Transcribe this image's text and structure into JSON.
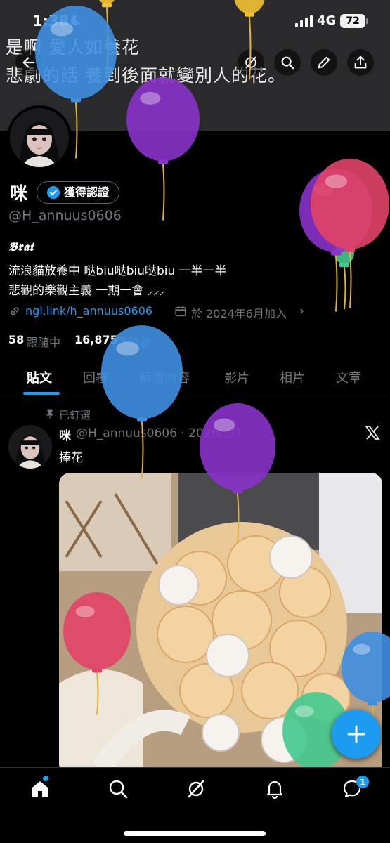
{
  "status_bar": {
    "time": "1:38",
    "network": "4G",
    "battery": "72"
  },
  "banner": {
    "line1": "是啊 愛人如養花",
    "line2": "悲劇的話 養到後面就變別人的花。"
  },
  "profile": {
    "name": "咪",
    "verify_label": "獲得認證",
    "handle": "@H_annuus0606",
    "bio_title": "𝕭𝖗𝖆𝖙",
    "bio_line1": "流浪貓放養中 哒biu哒biu哒biu 一半一半",
    "bio_line2": "悲觀的樂觀主義 一期一會 ⸝⸝⸝",
    "link": "ngl.link/h_annuus0606",
    "joined": "於 2024年6月加入",
    "following_count": "58",
    "following_label": "跟隨中",
    "followers_count": "16,875",
    "followers_label": "跟隨者"
  },
  "tabs": [
    {
      "label": "貼文",
      "active": true
    },
    {
      "label": "回覆",
      "active": false
    },
    {
      "label": "精選內容",
      "active": false
    },
    {
      "label": "影片",
      "active": false
    },
    {
      "label": "相片",
      "active": false
    },
    {
      "label": "文章",
      "active": false
    }
  ],
  "pinned_post": {
    "pinned_label": "已釘選",
    "author_name": "咪",
    "handle_date": "@H_annuus0606 · 2026/2/7",
    "text": "捧花"
  },
  "bottom_nav": {
    "message_badge": "1"
  },
  "icons": {
    "banner_buttons": [
      "back-icon",
      "grok-icon",
      "search-icon",
      "edit-icon",
      "share-icon"
    ],
    "bottom_nav": [
      "home-icon",
      "search-icon",
      "grok-icon",
      "bell-icon",
      "messages-icon"
    ],
    "fab": "plus-icon"
  },
  "colors": {
    "accent": "#1d9bf0",
    "background": "#000000",
    "secondary_text": "#71767b"
  },
  "balloons": [
    {
      "color": "yellow",
      "fill": "#f2c232"
    },
    {
      "color": "yellow",
      "fill": "#f2c232"
    },
    {
      "color": "blue",
      "fill": "#3f8fe0"
    },
    {
      "color": "green",
      "fill": "#44c98f"
    },
    {
      "color": "purple",
      "fill": "#8a32c9"
    },
    {
      "color": "purple",
      "fill": "#8a32c9"
    },
    {
      "color": "red",
      "fill": "#e24266"
    },
    {
      "color": "blue",
      "fill": "#3f8fe0"
    },
    {
      "color": "purple",
      "fill": "#8a32c9"
    },
    {
      "color": "red",
      "fill": "#e24266"
    },
    {
      "color": "blue",
      "fill": "#3f8fe0"
    },
    {
      "color": "green",
      "fill": "#44c98f"
    }
  ]
}
